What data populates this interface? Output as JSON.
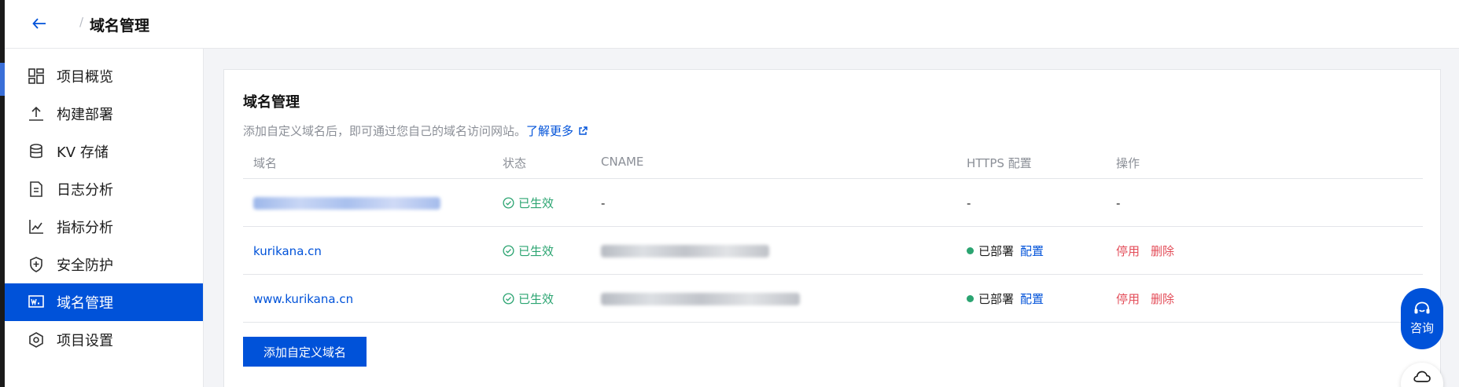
{
  "header": {
    "breadcrumb_sep": "/",
    "title": "域名管理"
  },
  "sidebar": {
    "items": [
      {
        "label": "项目概览",
        "icon": "dashboard-icon"
      },
      {
        "label": "构建部署",
        "icon": "upload-icon"
      },
      {
        "label": "KV 存储",
        "icon": "database-icon"
      },
      {
        "label": "日志分析",
        "icon": "log-icon"
      },
      {
        "label": "指标分析",
        "icon": "line-chart-icon"
      },
      {
        "label": "安全防护",
        "icon": "shield-icon"
      },
      {
        "label": "域名管理",
        "icon": "domain-icon",
        "active": true
      },
      {
        "label": "项目设置",
        "icon": "settings-icon"
      }
    ]
  },
  "card": {
    "title": "域名管理",
    "description": "添加自定义域名后，即可通过您自己的域名访问网站。",
    "learn_more": "了解更多"
  },
  "table": {
    "columns": [
      "域名",
      "状态",
      "CNAME",
      "HTTPS 配置",
      "操作"
    ],
    "rows": [
      {
        "domain": "",
        "domain_blurred": true,
        "status": "已生效",
        "cname": "-",
        "https": "-",
        "ops": "-"
      },
      {
        "domain": "kurikana.cn",
        "status": "已生效",
        "cname_blurred": true,
        "https_status": "已部署",
        "https_action": "配置",
        "op_disable": "停用",
        "op_delete": "删除"
      },
      {
        "domain": "www.kurikana.cn",
        "status": "已生效",
        "cname_blurred": true,
        "https_status": "已部署",
        "https_action": "配置",
        "op_disable": "停用",
        "op_delete": "删除"
      }
    ]
  },
  "add_button": "添加自定义域名",
  "consult": {
    "label": "咨询"
  },
  "colors": {
    "primary": "#0052d9",
    "success": "#2ba471",
    "danger": "#e34d59",
    "muted": "#8b8f97"
  }
}
